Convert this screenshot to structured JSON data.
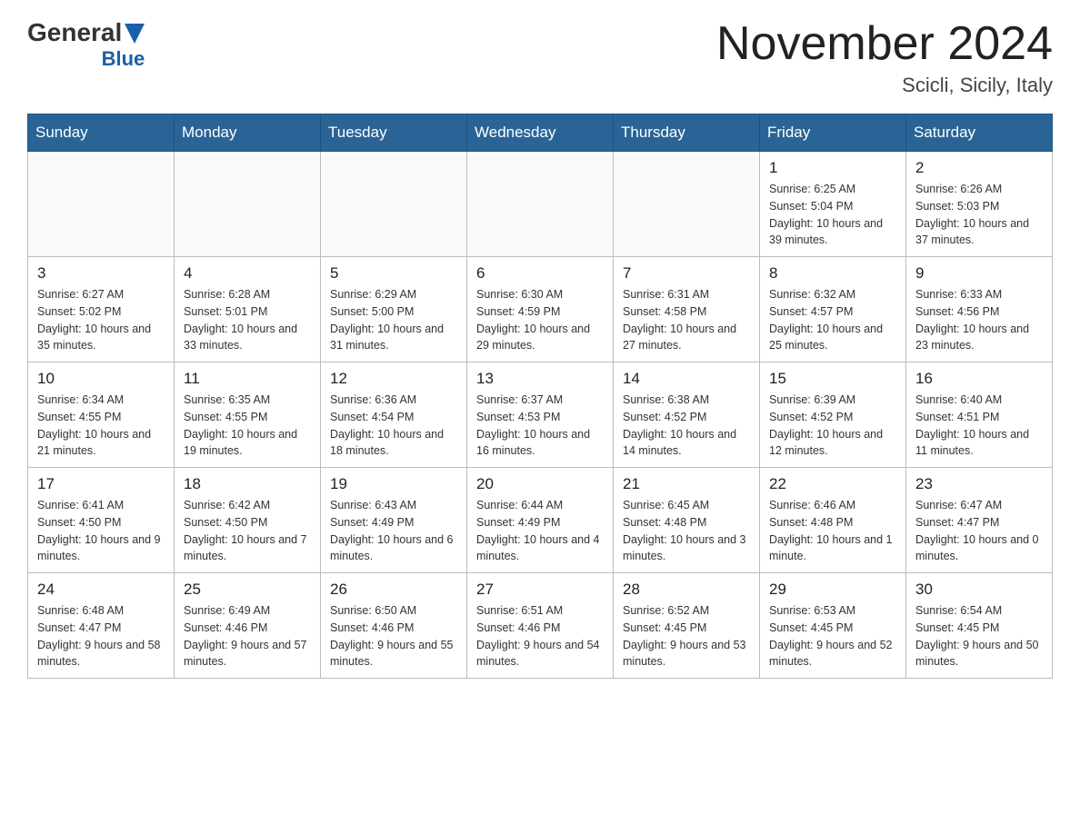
{
  "header": {
    "logo_general": "General",
    "logo_blue": "Blue",
    "title": "November 2024",
    "subtitle": "Scicli, Sicily, Italy"
  },
  "days_of_week": [
    "Sunday",
    "Monday",
    "Tuesday",
    "Wednesday",
    "Thursday",
    "Friday",
    "Saturday"
  ],
  "weeks": [
    [
      {
        "day": "",
        "info": ""
      },
      {
        "day": "",
        "info": ""
      },
      {
        "day": "",
        "info": ""
      },
      {
        "day": "",
        "info": ""
      },
      {
        "day": "",
        "info": ""
      },
      {
        "day": "1",
        "info": "Sunrise: 6:25 AM\nSunset: 5:04 PM\nDaylight: 10 hours and 39 minutes."
      },
      {
        "day": "2",
        "info": "Sunrise: 6:26 AM\nSunset: 5:03 PM\nDaylight: 10 hours and 37 minutes."
      }
    ],
    [
      {
        "day": "3",
        "info": "Sunrise: 6:27 AM\nSunset: 5:02 PM\nDaylight: 10 hours and 35 minutes."
      },
      {
        "day": "4",
        "info": "Sunrise: 6:28 AM\nSunset: 5:01 PM\nDaylight: 10 hours and 33 minutes."
      },
      {
        "day": "5",
        "info": "Sunrise: 6:29 AM\nSunset: 5:00 PM\nDaylight: 10 hours and 31 minutes."
      },
      {
        "day": "6",
        "info": "Sunrise: 6:30 AM\nSunset: 4:59 PM\nDaylight: 10 hours and 29 minutes."
      },
      {
        "day": "7",
        "info": "Sunrise: 6:31 AM\nSunset: 4:58 PM\nDaylight: 10 hours and 27 minutes."
      },
      {
        "day": "8",
        "info": "Sunrise: 6:32 AM\nSunset: 4:57 PM\nDaylight: 10 hours and 25 minutes."
      },
      {
        "day": "9",
        "info": "Sunrise: 6:33 AM\nSunset: 4:56 PM\nDaylight: 10 hours and 23 minutes."
      }
    ],
    [
      {
        "day": "10",
        "info": "Sunrise: 6:34 AM\nSunset: 4:55 PM\nDaylight: 10 hours and 21 minutes."
      },
      {
        "day": "11",
        "info": "Sunrise: 6:35 AM\nSunset: 4:55 PM\nDaylight: 10 hours and 19 minutes."
      },
      {
        "day": "12",
        "info": "Sunrise: 6:36 AM\nSunset: 4:54 PM\nDaylight: 10 hours and 18 minutes."
      },
      {
        "day": "13",
        "info": "Sunrise: 6:37 AM\nSunset: 4:53 PM\nDaylight: 10 hours and 16 minutes."
      },
      {
        "day": "14",
        "info": "Sunrise: 6:38 AM\nSunset: 4:52 PM\nDaylight: 10 hours and 14 minutes."
      },
      {
        "day": "15",
        "info": "Sunrise: 6:39 AM\nSunset: 4:52 PM\nDaylight: 10 hours and 12 minutes."
      },
      {
        "day": "16",
        "info": "Sunrise: 6:40 AM\nSunset: 4:51 PM\nDaylight: 10 hours and 11 minutes."
      }
    ],
    [
      {
        "day": "17",
        "info": "Sunrise: 6:41 AM\nSunset: 4:50 PM\nDaylight: 10 hours and 9 minutes."
      },
      {
        "day": "18",
        "info": "Sunrise: 6:42 AM\nSunset: 4:50 PM\nDaylight: 10 hours and 7 minutes."
      },
      {
        "day": "19",
        "info": "Sunrise: 6:43 AM\nSunset: 4:49 PM\nDaylight: 10 hours and 6 minutes."
      },
      {
        "day": "20",
        "info": "Sunrise: 6:44 AM\nSunset: 4:49 PM\nDaylight: 10 hours and 4 minutes."
      },
      {
        "day": "21",
        "info": "Sunrise: 6:45 AM\nSunset: 4:48 PM\nDaylight: 10 hours and 3 minutes."
      },
      {
        "day": "22",
        "info": "Sunrise: 6:46 AM\nSunset: 4:48 PM\nDaylight: 10 hours and 1 minute."
      },
      {
        "day": "23",
        "info": "Sunrise: 6:47 AM\nSunset: 4:47 PM\nDaylight: 10 hours and 0 minutes."
      }
    ],
    [
      {
        "day": "24",
        "info": "Sunrise: 6:48 AM\nSunset: 4:47 PM\nDaylight: 9 hours and 58 minutes."
      },
      {
        "day": "25",
        "info": "Sunrise: 6:49 AM\nSunset: 4:46 PM\nDaylight: 9 hours and 57 minutes."
      },
      {
        "day": "26",
        "info": "Sunrise: 6:50 AM\nSunset: 4:46 PM\nDaylight: 9 hours and 55 minutes."
      },
      {
        "day": "27",
        "info": "Sunrise: 6:51 AM\nSunset: 4:46 PM\nDaylight: 9 hours and 54 minutes."
      },
      {
        "day": "28",
        "info": "Sunrise: 6:52 AM\nSunset: 4:45 PM\nDaylight: 9 hours and 53 minutes."
      },
      {
        "day": "29",
        "info": "Sunrise: 6:53 AM\nSunset: 4:45 PM\nDaylight: 9 hours and 52 minutes."
      },
      {
        "day": "30",
        "info": "Sunrise: 6:54 AM\nSunset: 4:45 PM\nDaylight: 9 hours and 50 minutes."
      }
    ]
  ]
}
